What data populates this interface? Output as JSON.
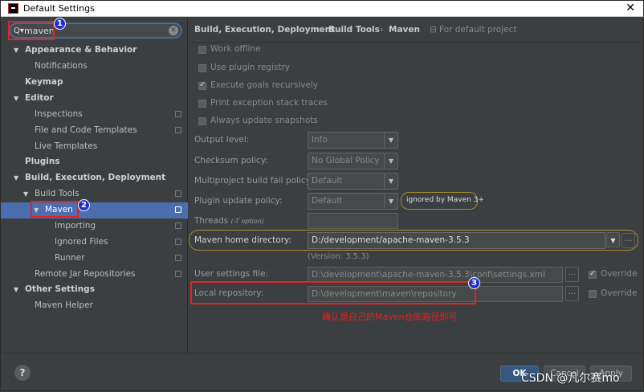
{
  "window": {
    "title": "Default Settings",
    "close": "✕"
  },
  "search": {
    "value": "maven",
    "icon": "Q▾",
    "clear": "✕"
  },
  "tree": [
    {
      "label": "Appearance & Behavior",
      "arrow": "▼"
    },
    {
      "label": "Notifications"
    },
    {
      "label": "Keymap"
    },
    {
      "label": "Editor",
      "arrow": "▼"
    },
    {
      "label": "Inspections"
    },
    {
      "label": "File and Code Templates"
    },
    {
      "label": "Live Templates"
    },
    {
      "label": "Plugins"
    },
    {
      "label": "Build, Execution, Deployment",
      "arrow": "▼"
    },
    {
      "label": "Build Tools",
      "arrow": "▼"
    },
    {
      "label": "Maven",
      "arrow": "▼"
    },
    {
      "label": "Importing"
    },
    {
      "label": "Ignored Files"
    },
    {
      "label": "Runner"
    },
    {
      "label": "Remote Jar Repositories"
    },
    {
      "label": "Other Settings",
      "arrow": "▼"
    },
    {
      "label": "Maven Helper"
    }
  ],
  "breadcrumb": {
    "items": [
      "Build, Execution, Deployment",
      "Build Tools",
      "Maven"
    ],
    "separator": "›",
    "scope": "For default project",
    "scope_icon": "⊟"
  },
  "checkboxes": [
    {
      "label": "Work offline",
      "checked": false
    },
    {
      "label": "Use plugin registry",
      "checked": false
    },
    {
      "label": "Execute goals recursively",
      "checked": true
    },
    {
      "label": "Print exception stack traces",
      "checked": false
    },
    {
      "label": "Always update snapshots",
      "checked": false
    }
  ],
  "settings": {
    "output_level": {
      "label": "Output level:",
      "value": "Info"
    },
    "checksum_policy": {
      "label": "Checksum policy:",
      "value": "No Global Policy"
    },
    "fail_policy": {
      "label": "Multiproject build fail policy:",
      "value": "Default"
    },
    "plugin_update": {
      "label": "Plugin update policy:",
      "value": "Default",
      "note": "ignored by Maven 3+"
    },
    "threads": {
      "label": "Threads",
      "hint": "(-T option)",
      "value": ""
    },
    "maven_home": {
      "label": "Maven home directory:",
      "value": "D:/development/apache-maven-3.5.3",
      "version": "(Version: 3.5.3)"
    },
    "user_settings": {
      "label": "User settings file:",
      "value": "D:\\development\\apache-maven-3.5.3\\conf\\settings.xml",
      "override_label": "Override",
      "override": true
    },
    "local_repo": {
      "label": "Local repository:",
      "value": "D:\\development\\maven\\repository",
      "override_label": "Override",
      "override": false
    }
  },
  "dots": "...",
  "dropdown_arrow": "▼",
  "annotation": {
    "text": "确认是自己的Maven仓库路径即可",
    "color": "#e82020"
  },
  "badges": [
    "1",
    "2",
    "3"
  ],
  "footer": {
    "help": "?",
    "ok": "OK",
    "cancel": "Cancel",
    "apply": "Apply"
  },
  "watermark": "CSDN @凡尔赛mo"
}
